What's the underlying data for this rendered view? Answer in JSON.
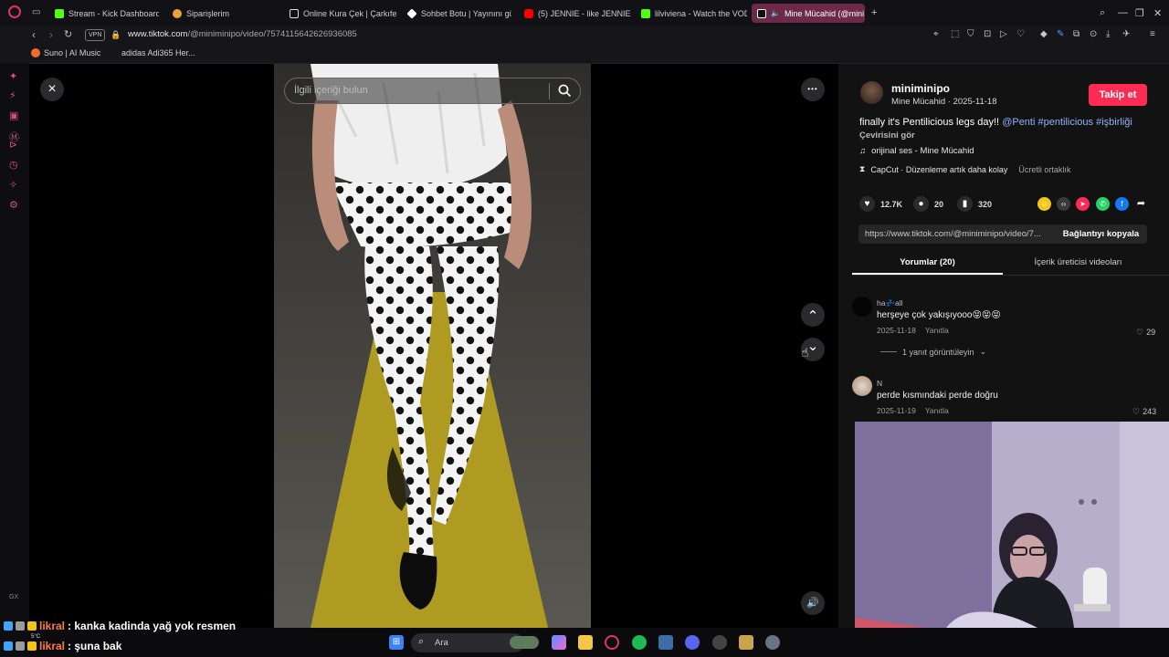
{
  "tabs": [
    {
      "label": "Stream - Kick Dashboard",
      "color": "#53fc18"
    },
    {
      "label": "Siparişlerim",
      "color": "#e8a23a"
    },
    {
      "label": "Online Kura Çek | Çarkıfel",
      "color": "#dddddd"
    },
    {
      "label": "Sohbet Botu | Yayınını güç",
      "color": "#ffffff"
    },
    {
      "label": "(5) JENNIE - like JENNIE (",
      "color": "#ff0000"
    },
    {
      "label": "lilviviena - Watch the VOD",
      "color": "#53fc18"
    },
    {
      "label": "Mine Mücahid (@mini",
      "color": "#ffffff"
    }
  ],
  "address": {
    "vpn": "VPN",
    "domain": "www.tiktok.com",
    "path": "/@miniminipo/video/7574115642626936085"
  },
  "bookmarks": [
    "Suno | AI Music",
    "adidas Adi365 Her..."
  ],
  "player": {
    "search_placeholder": "İlgili içeriği bulun",
    "close_icon": "×",
    "more_icon": "•••",
    "up_icon": "⌃",
    "down_icon": "⌄",
    "volume_icon": "🔊"
  },
  "creator": {
    "username": "miniminipo",
    "display_name": "Mine Mücahid",
    "date": "2025-11-18",
    "follow_label": "Takip et"
  },
  "caption": {
    "text": "finally it's Pentilicious legs day!!",
    "mention": "@Penti",
    "hashtags": "#pentilicious #işbirliği",
    "translate": "Çevirisini gör"
  },
  "music": "orijinal ses - Mine Mücahid",
  "capcut": {
    "text": "CapCut · Düzenleme artık daha kolay",
    "pill": "Ücretli ortaklık"
  },
  "stats": {
    "likes": "12.7K",
    "comments": "20",
    "saves": "320"
  },
  "share_colors": [
    "#f5c518",
    "#3a3a3a",
    "#fe2c55",
    "#25d366",
    "#1877f2"
  ],
  "link": {
    "url": "https://www.tiktok.com/@miniminipo/video/7...",
    "copy_label": "Bağlantıyı kopyala"
  },
  "panel_tabs": {
    "comments": "Yorumlar (20)",
    "creator_videos": "İçerik üreticisi videoları"
  },
  "comments": [
    {
      "name": "ha💤all",
      "text": "herşeye çok yakışıyooo😝😝😝",
      "date": "2025-11-18",
      "reply": "Yanıtla",
      "likes": "29"
    },
    {
      "name": "N",
      "text": "perde kısmındaki perde doğru",
      "date": "2025-11-19",
      "reply": "Yanıtla",
      "likes": "243"
    }
  ],
  "view_replies": "1 yanıt görüntüleyin",
  "chat": [
    {
      "user": "likral",
      "message": ": kanka kadinda yağ yok resmen"
    },
    {
      "user": "likral",
      "message": ": şuna bak"
    }
  ],
  "weather": "5°C",
  "taskbar": {
    "search_label": "Ara"
  },
  "accent": "#fe2c55",
  "link_color": "#8fb3ff"
}
